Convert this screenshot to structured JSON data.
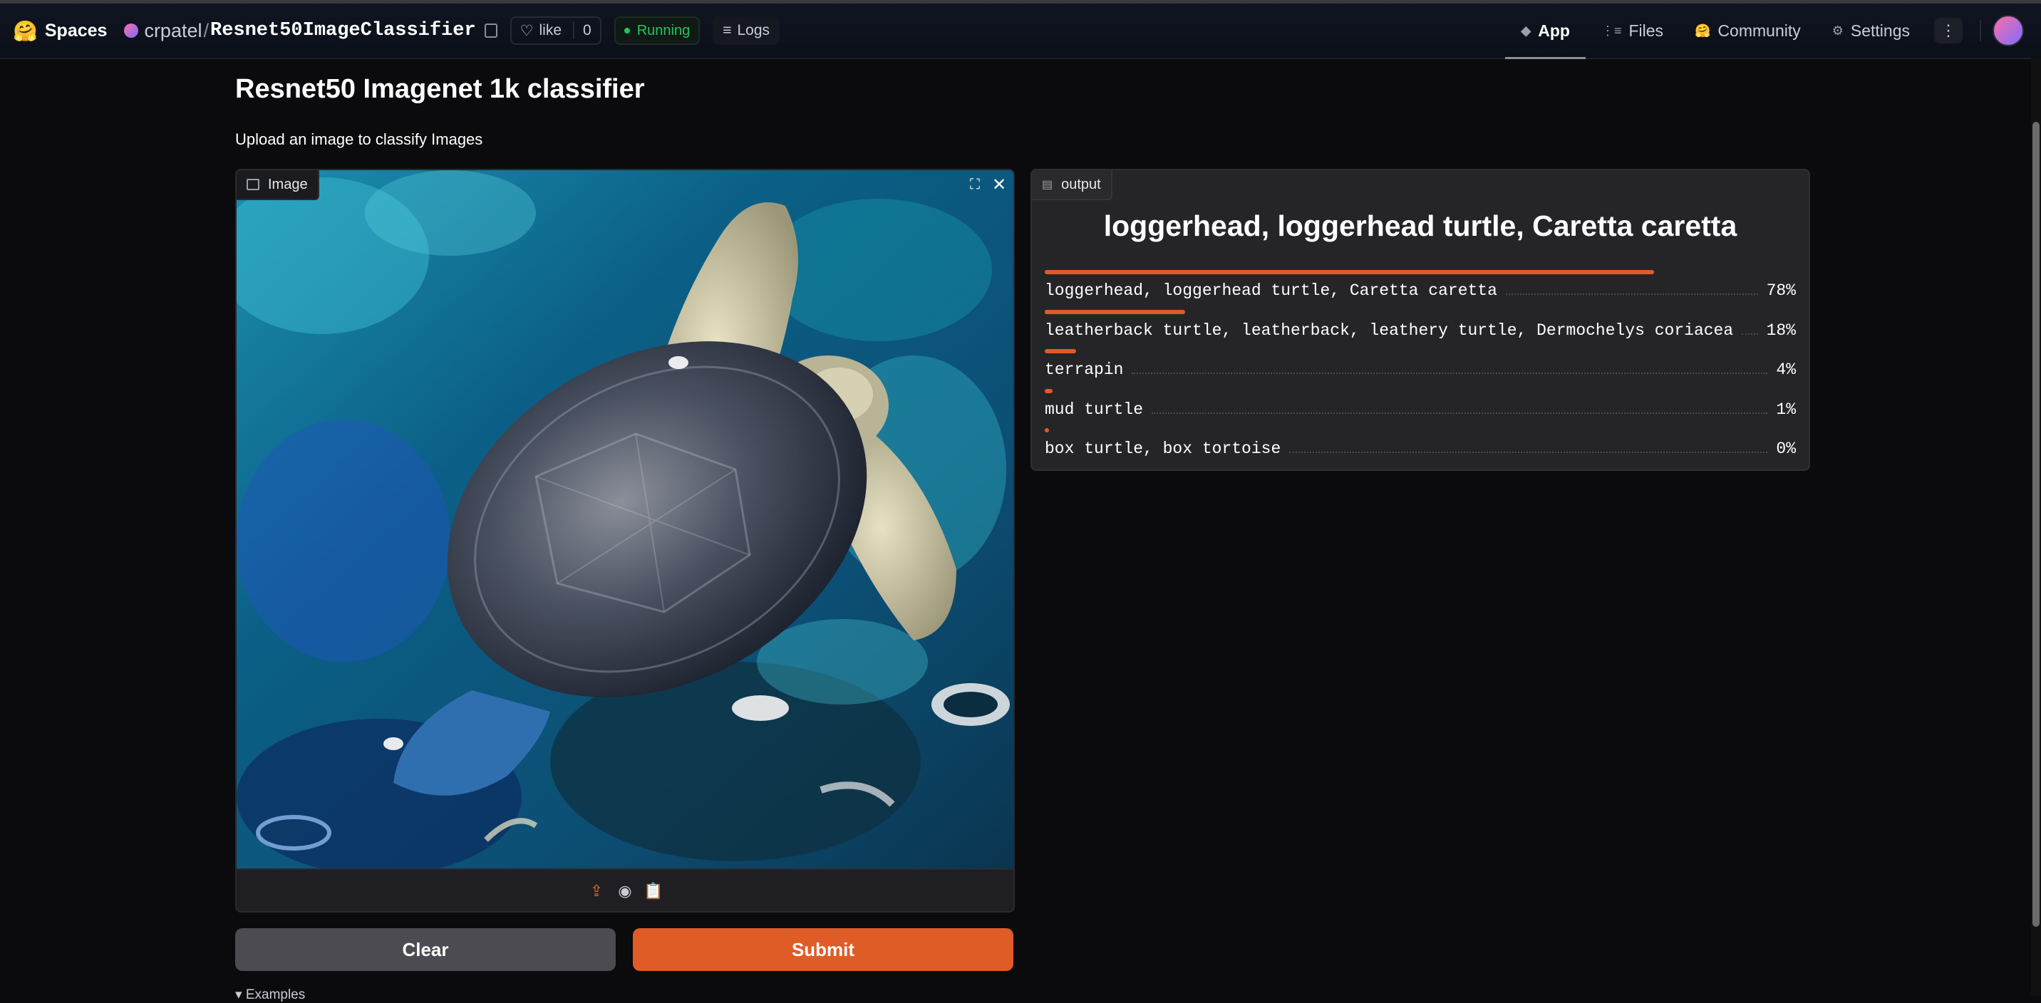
{
  "nav": {
    "spaces_label": "Spaces",
    "owner": "crpatel",
    "slash": "/",
    "repo": "Resnet50ImageClassifier",
    "like_label": "like",
    "like_count": "0",
    "status": "Running",
    "logs_label": "Logs",
    "tabs": [
      {
        "label": "App",
        "icon": "cube-icon"
      },
      {
        "label": "Files",
        "icon": "files-icon"
      },
      {
        "label": "Community",
        "icon": "community-icon"
      },
      {
        "label": "Settings",
        "icon": "gear-icon"
      }
    ],
    "accent_color": "#e05c26",
    "status_color": "#22c55e"
  },
  "page": {
    "title": "Resnet50 Imagenet 1k classifier",
    "description": "Upload an image to classify Images"
  },
  "input": {
    "label": "Image",
    "image_subject": "sea turtle swimming"
  },
  "buttons": {
    "clear": "Clear",
    "submit": "Submit"
  },
  "examples_label": "Examples",
  "output": {
    "label": "output",
    "top_label": "loggerhead, loggerhead turtle, Caretta caretta",
    "confidences": [
      {
        "label": "loggerhead, loggerhead turtle, Caretta caretta",
        "percent": "78%",
        "value": 78
      },
      {
        "label": "leatherback turtle, leatherback, leathery turtle, Dermochelys coriacea",
        "percent": "18%",
        "value": 18
      },
      {
        "label": "terrapin",
        "percent": "4%",
        "value": 4
      },
      {
        "label": "mud turtle",
        "percent": "1%",
        "value": 1
      },
      {
        "label": "box turtle, box tortoise",
        "percent": "0%",
        "value": 0
      }
    ]
  }
}
